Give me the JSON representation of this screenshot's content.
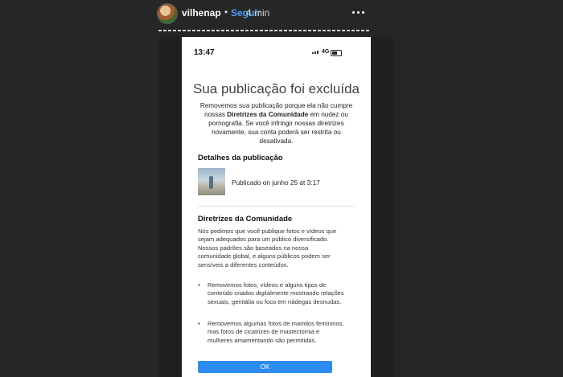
{
  "story": {
    "username": "vilhenap",
    "dot": "•",
    "follow_label": "Seguir",
    "time_ago": "4 min",
    "icons": {
      "more": "more-options-icon",
      "close": "close-icon"
    },
    "colors": {
      "follow": "#4aa3f7",
      "background": "#262626"
    }
  },
  "phone": {
    "clock": "13:47",
    "network": "4G"
  },
  "notice": {
    "title": "Sua publicação foi excluída",
    "intro_1": "Removemos sua publicação porque ela não cumpre nossas ",
    "intro_bold": "Diretrizes da Comunidade",
    "intro_2": " em nudez ou pornografia. Se você infringir nossas diretrizes novamente, sua conta poderá ser restrita ou desativada.",
    "details_heading": "Detalhes da publicação",
    "post_date": "Publicado on junho 25 at 3:17",
    "guidelines_heading": "Diretrizes da Comunidade",
    "guidelines_text": "Nós pedimos que você publique fotos e vídeos que sejam adequados para um público diversificado. Nossos padrões são baseados na nossa comunidade global, e alguns públicos podem ser sensíveis a diferentes conteúdos.",
    "bullets": [
      "Removemos fotos, vídeos e alguns tipos de conteúdo criados digitalmente mostrando relações sexuais, genitália ou foco em nádegas desnudas.",
      "Removemos algumas fotos de mamilos femininos, mas fotos de cicatrizes de mastectomia e mulheres amamentando são permitidas."
    ],
    "ok_label": "OK",
    "colors": {
      "ok_button": "#2d8cf0"
    }
  }
}
